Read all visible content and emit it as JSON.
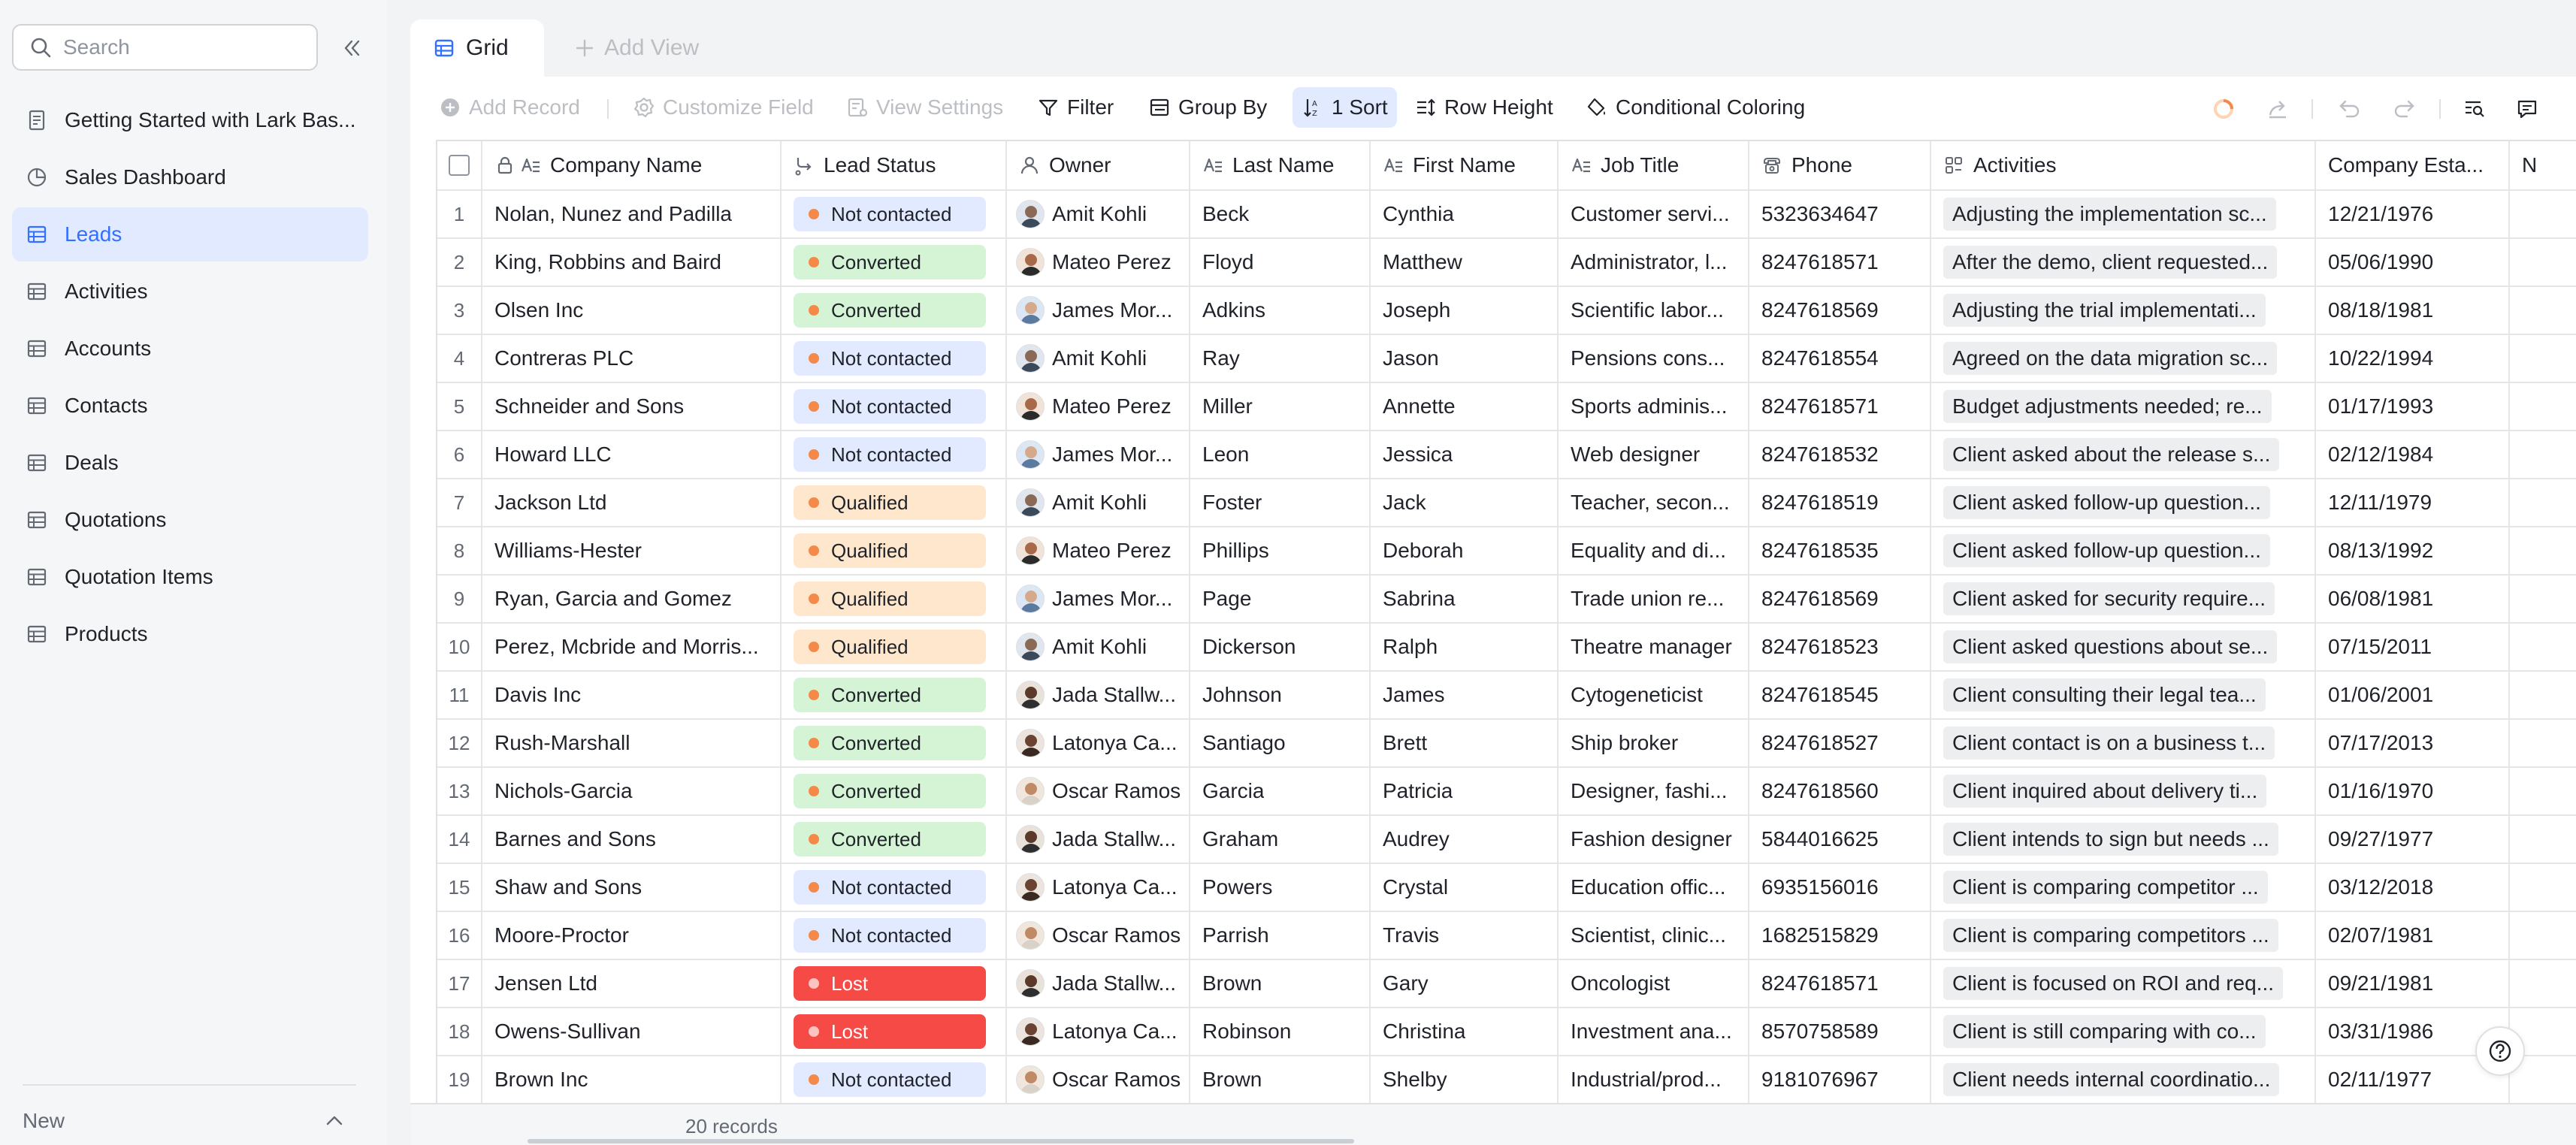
{
  "sidebar": {
    "search_placeholder": "Search",
    "items": [
      {
        "label": "Getting Started with Lark Bas...",
        "icon": "doc-icon"
      },
      {
        "label": "Sales Dashboard",
        "icon": "dashboard-icon"
      },
      {
        "label": "Leads",
        "icon": "table-icon",
        "active": true
      },
      {
        "label": "Activities",
        "icon": "table-icon"
      },
      {
        "label": "Accounts",
        "icon": "table-icon"
      },
      {
        "label": "Contacts",
        "icon": "table-icon"
      },
      {
        "label": "Deals",
        "icon": "table-icon"
      },
      {
        "label": "Quotations",
        "icon": "table-icon"
      },
      {
        "label": "Quotation Items",
        "icon": "table-icon"
      },
      {
        "label": "Products",
        "icon": "table-icon"
      }
    ],
    "footer_label": "New"
  },
  "tabs": {
    "grid_label": "Grid",
    "add_view_label": "Add View"
  },
  "toolbar": {
    "add_record": "Add Record",
    "customize_field": "Customize Field",
    "view_settings": "View Settings",
    "filter": "Filter",
    "group_by": "Group By",
    "sort": "1 Sort",
    "row_height": "Row Height",
    "conditional_coloring": "Conditional Coloring"
  },
  "grid": {
    "columns": [
      {
        "key": "company",
        "label": "Company Name"
      },
      {
        "key": "status",
        "label": "Lead Status"
      },
      {
        "key": "owner",
        "label": "Owner"
      },
      {
        "key": "last",
        "label": "Last Name"
      },
      {
        "key": "first",
        "label": "First Name"
      },
      {
        "key": "job",
        "label": "Job Title"
      },
      {
        "key": "phone",
        "label": "Phone"
      },
      {
        "key": "activities",
        "label": "Activities"
      },
      {
        "key": "established",
        "label": "Company Esta..."
      },
      {
        "key": "more",
        "label": "N"
      }
    ],
    "rows": [
      {
        "num": "1",
        "company": "Nolan, Nunez and Padilla",
        "status": "Not contacted",
        "owner": "Amit Kohli",
        "last": "Beck",
        "first": "Cynthia",
        "job": "Customer servi...",
        "phone": "5323634647",
        "activities": "Adjusting the implementation sc...",
        "established": "12/21/1976"
      },
      {
        "num": "2",
        "company": "King, Robbins and Baird",
        "status": "Converted",
        "owner": "Mateo Perez",
        "last": "Floyd",
        "first": "Matthew",
        "job": "Administrator, l...",
        "phone": "8247618571",
        "activities": "After the demo, client requested...",
        "established": "05/06/1990"
      },
      {
        "num": "3",
        "company": "Olsen Inc",
        "status": "Converted",
        "owner": "James Mor...",
        "last": "Adkins",
        "first": "Joseph",
        "job": "Scientific labor...",
        "phone": "8247618569",
        "activities": "Adjusting the trial implementati...",
        "established": "08/18/1981"
      },
      {
        "num": "4",
        "company": "Contreras PLC",
        "status": "Not contacted",
        "owner": "Amit Kohli",
        "last": "Ray",
        "first": "Jason",
        "job": "Pensions cons...",
        "phone": "8247618554",
        "activities": "Agreed on the data migration sc...",
        "established": "10/22/1994"
      },
      {
        "num": "5",
        "company": "Schneider and Sons",
        "status": "Not contacted",
        "owner": "Mateo Perez",
        "last": "Miller",
        "first": "Annette",
        "job": "Sports adminis...",
        "phone": "8247618571",
        "activities": "Budget adjustments needed; re...",
        "established": "01/17/1993"
      },
      {
        "num": "6",
        "company": "Howard LLC",
        "status": "Not contacted",
        "owner": "James Mor...",
        "last": "Leon",
        "first": "Jessica",
        "job": "Web designer",
        "phone": "8247618532",
        "activities": "Client asked about the release s...",
        "established": "02/12/1984"
      },
      {
        "num": "7",
        "company": "Jackson Ltd",
        "status": "Qualified",
        "owner": "Amit Kohli",
        "last": "Foster",
        "first": "Jack",
        "job": "Teacher, secon...",
        "phone": "8247618519",
        "activities": "Client asked follow-up question...",
        "established": "12/11/1979"
      },
      {
        "num": "8",
        "company": "Williams-Hester",
        "status": "Qualified",
        "owner": "Mateo Perez",
        "last": "Phillips",
        "first": "Deborah",
        "job": "Equality and di...",
        "phone": "8247618535",
        "activities": "Client asked follow-up question...",
        "established": "08/13/1992"
      },
      {
        "num": "9",
        "company": "Ryan, Garcia and Gomez",
        "status": "Qualified",
        "owner": "James Mor...",
        "last": "Page",
        "first": "Sabrina",
        "job": "Trade union re...",
        "phone": "8247618569",
        "activities": "Client asked for security require...",
        "established": "06/08/1981"
      },
      {
        "num": "10",
        "company": "Perez, Mcbride and Morris...",
        "status": "Qualified",
        "owner": "Amit Kohli",
        "last": "Dickerson",
        "first": "Ralph",
        "job": "Theatre manager",
        "phone": "8247618523",
        "activities": "Client asked questions about se...",
        "established": "07/15/2011"
      },
      {
        "num": "11",
        "company": "Davis Inc",
        "status": "Converted",
        "owner": "Jada Stallw...",
        "last": "Johnson",
        "first": "James",
        "job": "Cytogeneticist",
        "phone": "8247618545",
        "activities": "Client consulting their legal tea...",
        "established": "01/06/2001"
      },
      {
        "num": "12",
        "company": "Rush-Marshall",
        "status": "Converted",
        "owner": "Latonya Ca...",
        "last": "Santiago",
        "first": "Brett",
        "job": "Ship broker",
        "phone": "8247618527",
        "activities": "Client contact is on a business t...",
        "established": "07/17/2013"
      },
      {
        "num": "13",
        "company": "Nichols-Garcia",
        "status": "Converted",
        "owner": "Oscar Ramos",
        "last": "Garcia",
        "first": "Patricia",
        "job": "Designer, fashi...",
        "phone": "8247618560",
        "activities": "Client inquired about delivery ti...",
        "established": "01/16/1970"
      },
      {
        "num": "14",
        "company": "Barnes and Sons",
        "status": "Converted",
        "owner": "Jada Stallw...",
        "last": "Graham",
        "first": "Audrey",
        "job": "Fashion designer",
        "phone": "5844016625",
        "activities": "Client intends to sign but needs ...",
        "established": "09/27/1977"
      },
      {
        "num": "15",
        "company": "Shaw and Sons",
        "status": "Not contacted",
        "owner": "Latonya Ca...",
        "last": "Powers",
        "first": "Crystal",
        "job": "Education offic...",
        "phone": "6935156016",
        "activities": "Client is comparing competitor ...",
        "established": "03/12/2018"
      },
      {
        "num": "16",
        "company": "Moore-Proctor",
        "status": "Not contacted",
        "owner": "Oscar Ramos",
        "last": "Parrish",
        "first": "Travis",
        "job": "Scientist, clinic...",
        "phone": "1682515829",
        "activities": "Client is comparing competitors ...",
        "established": "02/07/1981"
      },
      {
        "num": "17",
        "company": "Jensen Ltd",
        "status": "Lost",
        "owner": "Jada Stallw...",
        "last": "Brown",
        "first": "Gary",
        "job": "Oncologist",
        "phone": "8247618571",
        "activities": "Client is focused on ROI and req...",
        "established": "09/21/1981"
      },
      {
        "num": "18",
        "company": "Owens-Sullivan",
        "status": "Lost",
        "owner": "Latonya Ca...",
        "last": "Robinson",
        "first": "Christina",
        "job": "Investment ana...",
        "phone": "8570758589",
        "activities": "Client is still comparing with co...",
        "established": "03/31/1986"
      },
      {
        "num": "19",
        "company": "Brown Inc",
        "status": "Not contacted",
        "owner": "Oscar Ramos",
        "last": "Brown",
        "first": "Shelby",
        "job": "Industrial/prod...",
        "phone": "9181076967",
        "activities": "Client needs internal coordinatio...",
        "established": "02/11/1977"
      }
    ],
    "records_count": "20 records"
  },
  "status_colors": {
    "Not contacted": {
      "bg": "#e1eaff",
      "dot": "#f5894a",
      "text": "#1f2329"
    },
    "Converted": {
      "bg": "#d5f4d5",
      "dot": "#f5894a",
      "text": "#1f2329"
    },
    "Qualified": {
      "bg": "#fee7cd",
      "dot": "#f5894a",
      "text": "#1f2329"
    },
    "Lost": {
      "bg": "#f54a45",
      "dot": "#fcc3c1",
      "text": "#ffffff"
    }
  },
  "owner_avatars": {
    "Amit Kohli": {
      "bg": "#dfe6ee",
      "skin": "#8a6a56",
      "shirt": "#3b4a5a"
    },
    "Mateo Perez": {
      "bg": "#f2e3d8",
      "skin": "#a8694a",
      "shirt": "#2b2b2b"
    },
    "James Mor...": {
      "bg": "#dbe7f3",
      "skin": "#d7a98c",
      "shirt": "#5a7aa0"
    },
    "Jada Stallw...": {
      "bg": "#e9e2da",
      "skin": "#5b3a2a",
      "shirt": "#2f2f2f"
    },
    "Latonya Ca...": {
      "bg": "#ece4de",
      "skin": "#6a4432",
      "shirt": "#3a2a22"
    },
    "Oscar Ramos": {
      "bg": "#f1e6dc",
      "skin": "#c08a67",
      "shirt": "#d9d2c8"
    }
  },
  "accent_color": "#3370ff"
}
